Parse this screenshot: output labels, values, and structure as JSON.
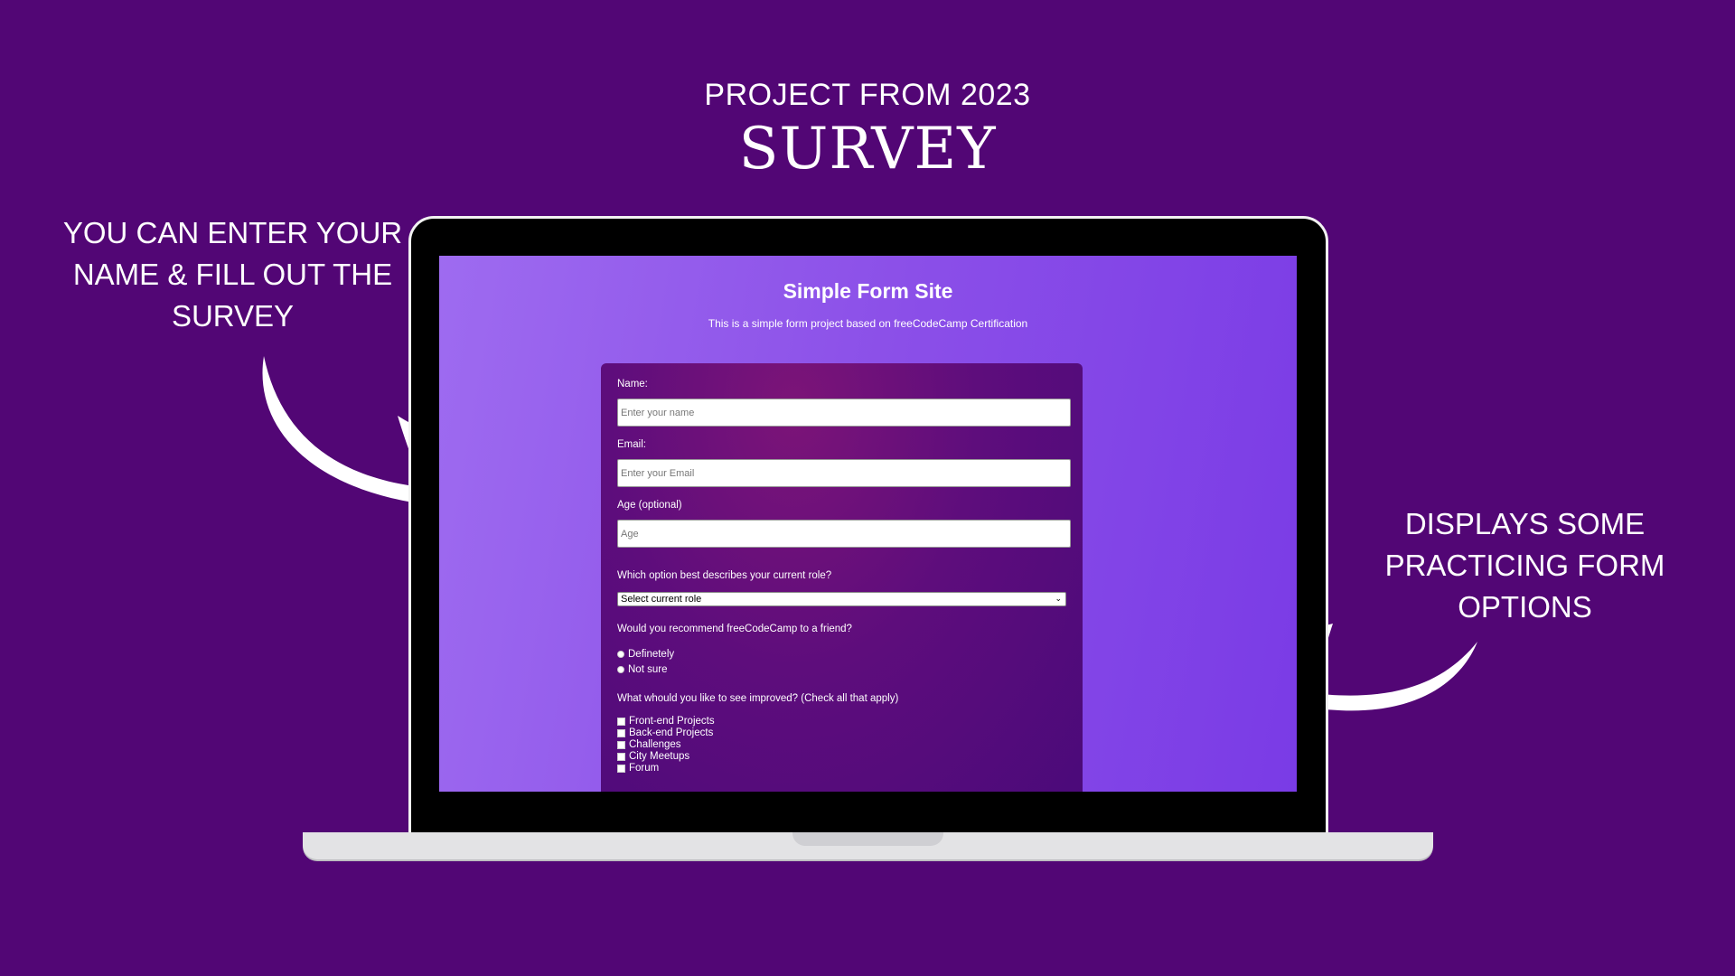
{
  "header": {
    "subtitle": "PROJECT FROM 2023",
    "title": "SURVEY"
  },
  "left_caption": "YOU CAN ENTER YOUR NAME & FILL OUT THE SURVEY",
  "right_caption": "DISPLAYS SOME PRACTICING FORM OPTIONS",
  "colors": {
    "background": "#520675",
    "screen_gradient": "#8b4fe8",
    "card": "#5e0d7c"
  },
  "site": {
    "title": "Simple Form Site",
    "description": "This is a simple form project based on freeCodeCamp Certification",
    "form": {
      "name_label": "Name:",
      "name_placeholder": "Enter your name",
      "email_label": "Email:",
      "email_placeholder": "Enter your Email",
      "age_label": "Age (optional)",
      "age_placeholder": "Age",
      "role_question": "Which option best describes your current role?",
      "role_selected": "Select current role",
      "recommend_question": "Would you recommend freeCodeCamp to a friend?",
      "recommend_options": [
        "Definetely",
        "Not sure"
      ],
      "improve_question": "What whould you like to see improved? (Check all that apply)",
      "improve_options": [
        "Front-end Projects",
        "Back-end Projects",
        "Challenges",
        "City Meetups",
        "Forum"
      ]
    }
  }
}
